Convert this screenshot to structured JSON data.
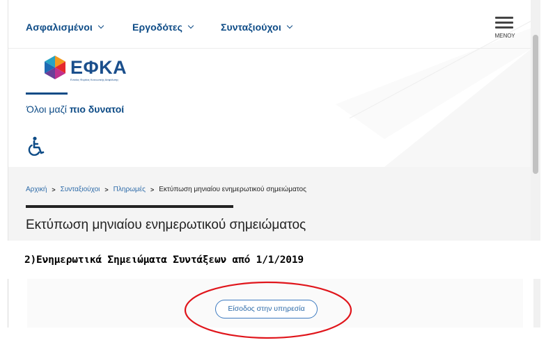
{
  "topnav": {
    "items": [
      {
        "label": "Ασφαλισμένοι"
      },
      {
        "label": "Εργοδότες"
      },
      {
        "label": "Συνταξιούχοι"
      }
    ],
    "menu_label": "ΜΕΝΟΥ"
  },
  "logo": {
    "text": "ΕΦΚΑ",
    "tagline": "Ενιαίος Φορέας Κοινωνικής Ασφάλισης"
  },
  "slogan": {
    "prefix": "Όλοι μαζί ",
    "bold": "πιο δυνατοί"
  },
  "breadcrumb": {
    "items": [
      "Αρχική",
      "Συνταξιούχοι",
      "Πληρωμές"
    ],
    "current": "Εκτύπωση μηνιαίου ενημερωτικού σημειώματος"
  },
  "page_title": "Εκτύπωση μηνιαίου ενημερωτικού σημειώματος",
  "doc_heading": "2)Ενημερωτικά Σημειώματα Συντάξεων από 1/1/2019",
  "service_button": "Είσοδος στην υπηρεσία",
  "colors": {
    "brand_blue": "#0d4b86",
    "link_blue": "#2c6aa8",
    "annotation_red": "#e0151b"
  },
  "icons": [
    "chevron-down-icon",
    "hamburger-menu-icon",
    "accessibility-icon",
    "breadcrumb-chevron-icon"
  ]
}
